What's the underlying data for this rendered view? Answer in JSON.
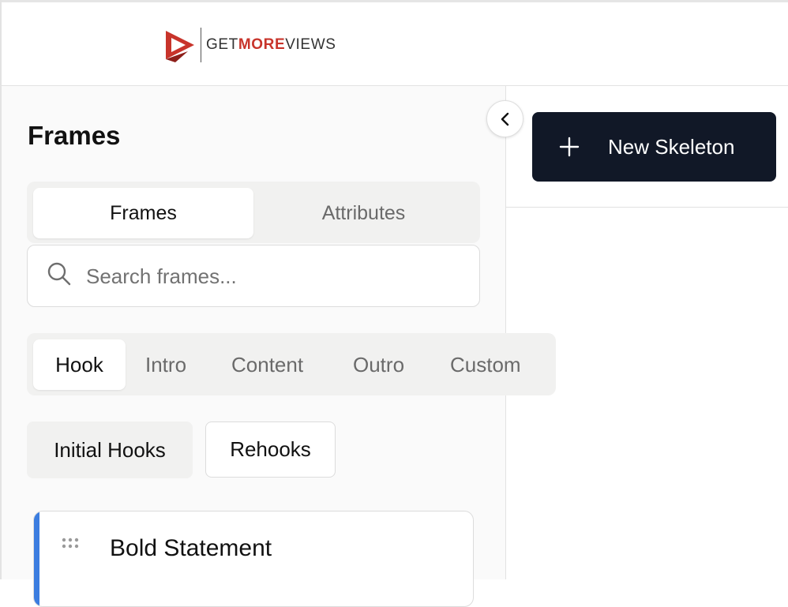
{
  "brand": {
    "logo_prefix": "GET",
    "logo_accent": "MORE",
    "logo_suffix": "VIEWS",
    "accent_color": "#c8342b"
  },
  "sidebar": {
    "title": "Frames",
    "segmented": {
      "tabs": [
        {
          "label": "Frames",
          "active": true
        },
        {
          "label": "Attributes",
          "active": false
        }
      ]
    },
    "search": {
      "placeholder": "Search frames...",
      "value": "",
      "icon": "search-icon"
    },
    "categories": [
      {
        "label": "Hook",
        "active": true
      },
      {
        "label": "Intro",
        "active": false
      },
      {
        "label": "Content",
        "active": false
      },
      {
        "label": "Outro",
        "active": false
      },
      {
        "label": "Custom",
        "active": false
      }
    ],
    "subcategories": [
      {
        "label": "Initial Hooks",
        "style": "filled"
      },
      {
        "label": "Rehooks",
        "style": "outlined"
      }
    ],
    "frames": [
      {
        "title": "Bold Statement",
        "accent_color": "#3b7de0"
      }
    ]
  },
  "toolbar": {
    "collapse_icon": "chevron-left-icon",
    "new_button_label": "New Skeleton",
    "new_button_icon": "plus-icon",
    "new_button_color": "#111827"
  }
}
